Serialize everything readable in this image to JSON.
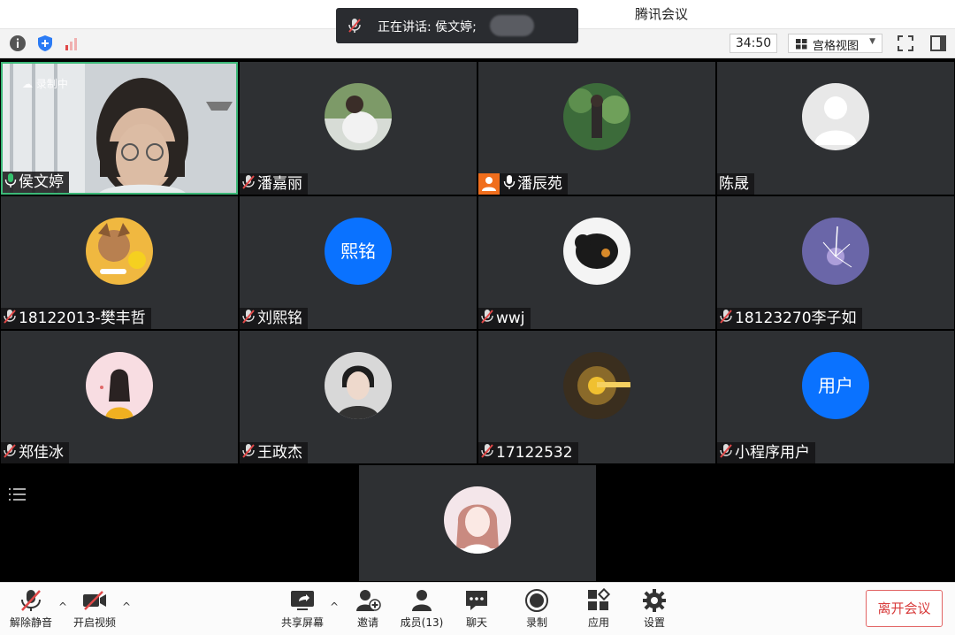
{
  "window": {
    "title": "腾讯会议"
  },
  "speaking_banner": {
    "text": "正在讲话: 侯文婷;"
  },
  "toolbar": {
    "timer": "34:50",
    "view_label": "宫格视图"
  },
  "recording_label": "录制中",
  "participants": [
    {
      "name": "侯文婷",
      "mic": "on",
      "avatar": "video-feed"
    },
    {
      "name": "潘嘉丽",
      "mic": "muted",
      "avatar": "photo"
    },
    {
      "name": "潘辰苑",
      "mic": "on",
      "avatar": "photo",
      "host": true
    },
    {
      "name": "陈晟",
      "mic": "none",
      "avatar": "default-person"
    },
    {
      "name": "18122013-樊丰哲",
      "mic": "muted",
      "avatar": "photo"
    },
    {
      "name": "刘熙铭",
      "mic": "muted",
      "avatar_text": "熙铭"
    },
    {
      "name": "wwj",
      "mic": "muted",
      "avatar": "photo"
    },
    {
      "name": "18123270李子如",
      "mic": "muted",
      "avatar": "photo"
    },
    {
      "name": "郑佳冰",
      "mic": "muted",
      "avatar": "photo"
    },
    {
      "name": "王政杰",
      "mic": "muted",
      "avatar": "photo"
    },
    {
      "name": "17122532",
      "mic": "muted",
      "avatar": "photo"
    },
    {
      "name": "小程序用户",
      "mic": "muted",
      "avatar_text": "用户"
    },
    {
      "name": "",
      "mic": "none",
      "avatar": "photo"
    }
  ],
  "bottom_bar": {
    "unmute": "解除静音",
    "start_video": "开启视频",
    "share_screen": "共享屏幕",
    "invite": "邀请",
    "members": "成员(13)",
    "chat": "聊天",
    "record": "录制",
    "apps": "应用",
    "settings": "设置",
    "leave": "离开会议"
  },
  "colors": {
    "accent": "#0a72ff",
    "active_border": "#3cb878",
    "leave": "#d83b3b",
    "host_badge": "#f06e1d"
  }
}
